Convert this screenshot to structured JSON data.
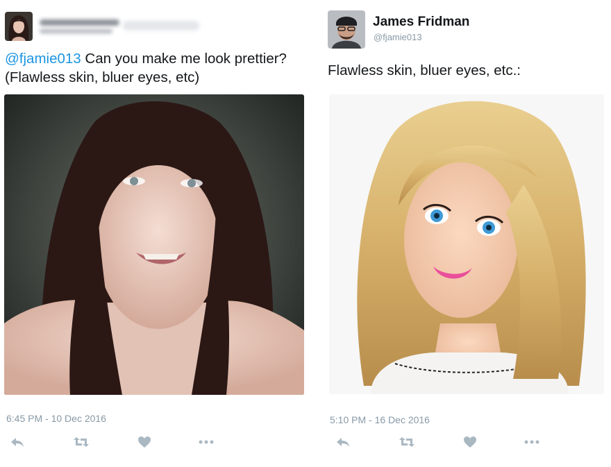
{
  "left_tweet": {
    "text_mention": "@fjamie013",
    "text_body_line1": " Can you make me look prettier?",
    "text_body_line2": "(Flawless skin, bluer eyes, etc)",
    "timestamp": "6:45 PM - 10 Dec 2016",
    "photo_icon": "selfie-photo"
  },
  "right_tweet": {
    "display_name": "James Fridman",
    "handle": "@fjamie013",
    "text": "Flawless skin, bluer eyes, etc.:",
    "timestamp": "5:10 PM - 16 Dec 2016",
    "photo_icon": "doll-photo"
  },
  "actions": [
    {
      "icon": "reply-icon"
    },
    {
      "icon": "retweet-icon"
    },
    {
      "icon": "like-icon"
    },
    {
      "icon": "more-icon"
    }
  ],
  "colors": {
    "mention": "#1b95e0",
    "meta_gray": "#8899a6",
    "action_gray": "#aab8c2"
  }
}
